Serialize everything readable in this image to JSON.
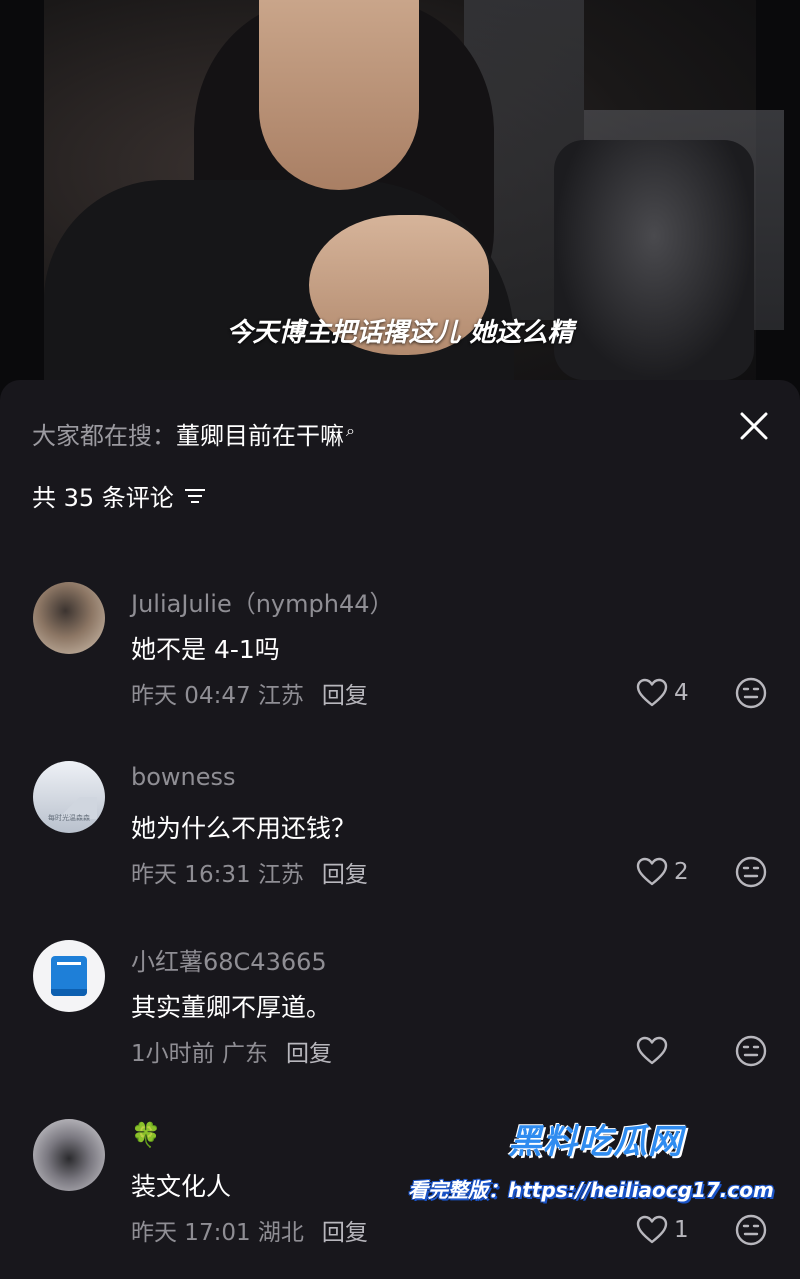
{
  "video": {
    "subtitle": "今天博主把话撂这儿 她这么精"
  },
  "search": {
    "prefix": "大家都在搜：",
    "term": "董卿目前在干嘛",
    "icon": "search-icon"
  },
  "header": {
    "count_label": "共 35 条评论",
    "filter_icon": "filter-icon",
    "close_icon": "close-icon"
  },
  "comments": [
    {
      "name": "JuliaJulie（nymph44）",
      "text": "她不是 4-1吗",
      "time": "昨天 04:47 江苏",
      "reply": "回复",
      "likes": "4"
    },
    {
      "name": "bowness",
      "text": "她为什么不用还钱？",
      "time": "昨天 16:31 江苏",
      "reply": "回复",
      "likes": "2",
      "avatar_caption": "每时光温森森"
    },
    {
      "name": "小红薯68C43665",
      "text": "其实董卿不厚道。",
      "time": "1小时前 广东",
      "reply": "回复",
      "likes": ""
    },
    {
      "name": "🍀",
      "text": "装文化人",
      "time": "昨天 17:01 湖北",
      "reply": "回复",
      "likes": "1"
    }
  ],
  "watermark": {
    "logo": "黑料吃瓜网",
    "text": "看完整版：https://heiliaocg17.com"
  },
  "colors": {
    "background": "#18171c",
    "muted_text": "#8f8e94",
    "watermark_blue": "#2f8cf0"
  }
}
